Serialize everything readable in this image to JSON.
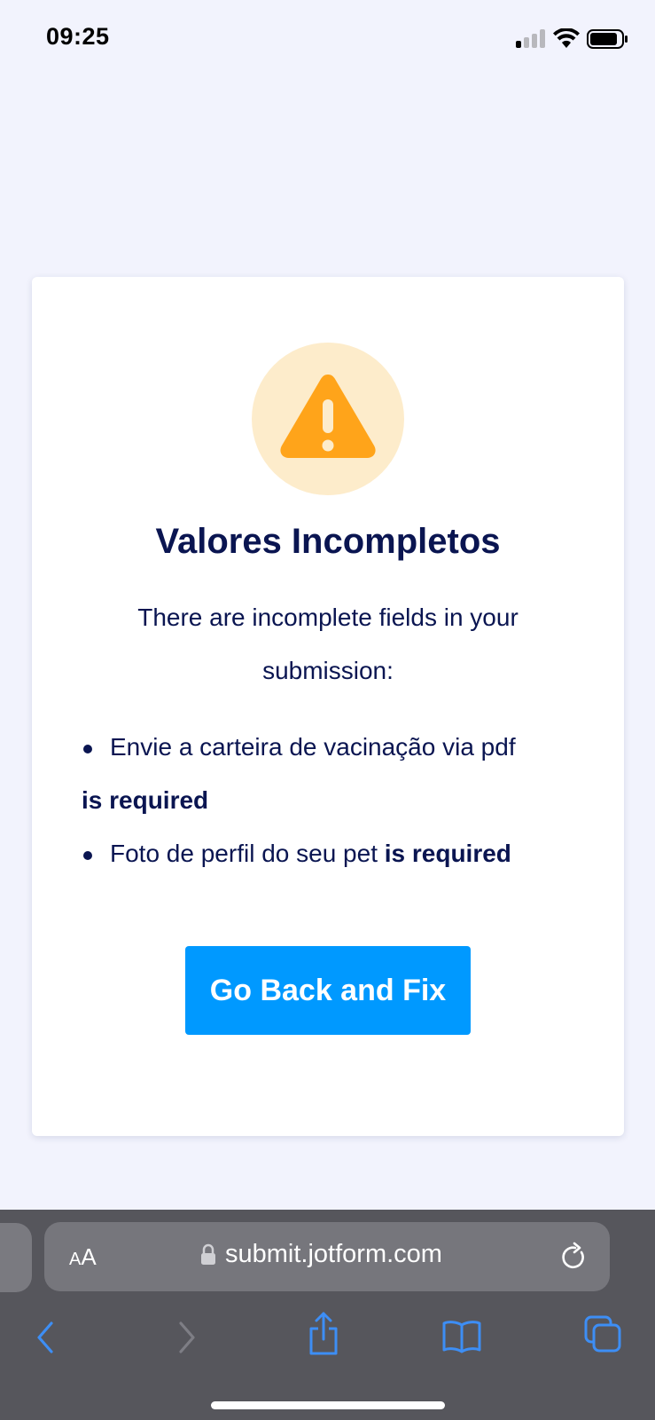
{
  "status_bar": {
    "time": "09:25",
    "icons": [
      "cellular-signal-icon",
      "wifi-icon",
      "battery-icon"
    ]
  },
  "card": {
    "icon": "warning-triangle-icon",
    "title": "Valores Incompletos",
    "message": "There are incomplete fields in your submission:",
    "errors": [
      {
        "field": "Envie a carteira de vacinação via pdf",
        "suffix": "is required"
      },
      {
        "field": "Foto de perfil do seu pet",
        "suffix": "is required"
      }
    ],
    "button_label": "Go Back and Fix"
  },
  "browser": {
    "aa_label_small": "A",
    "aa_label_large": "A",
    "url": "submit.jotform.com",
    "toolbar": [
      "back-icon",
      "forward-icon",
      "share-icon",
      "bookmarks-icon",
      "tabs-icon"
    ]
  },
  "colors": {
    "page_bg": "#f2f3fd",
    "text_dark": "#0a1551",
    "button_bg": "#0099ff",
    "warning_orange": "#ffa41a",
    "warning_circle": "#fdeccb",
    "browser_bar": "#56565c",
    "toolbar_icon": "#3d8ef5"
  }
}
